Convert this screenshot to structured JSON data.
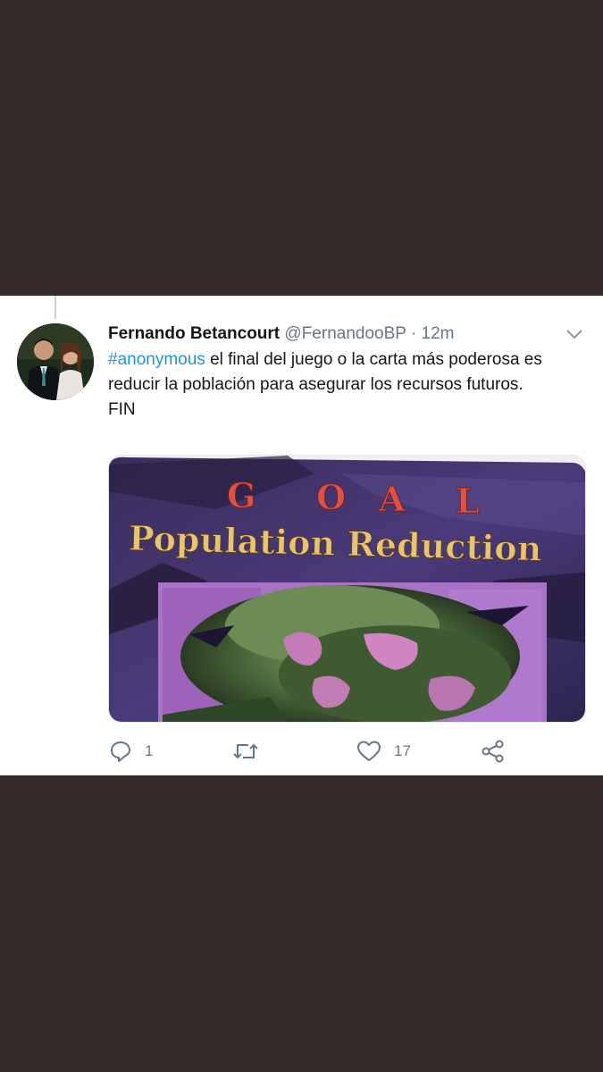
{
  "tweet": {
    "author_name": "Fernando Betancourt",
    "handle": "@FernandooBP",
    "separator": "·",
    "time": "12m",
    "hashtag": "#anonymous",
    "text_rest": " el final del juego o la carta más poderosa es reducir la población para asegurar los recursos futuros.",
    "text_end": "FIN"
  },
  "media": {
    "card_goal_word": "GOAL",
    "card_title": "Population Reduction"
  },
  "actions": {
    "reply_count": "1",
    "like_count": "17"
  },
  "colors": {
    "background": "#352b2b",
    "link": "#1b95e0",
    "muted": "#657786"
  },
  "icons": {
    "reply": "reply-icon",
    "retweet": "retweet-icon",
    "like": "heart-icon",
    "share": "share-icon",
    "menu": "chevron-down-icon"
  }
}
